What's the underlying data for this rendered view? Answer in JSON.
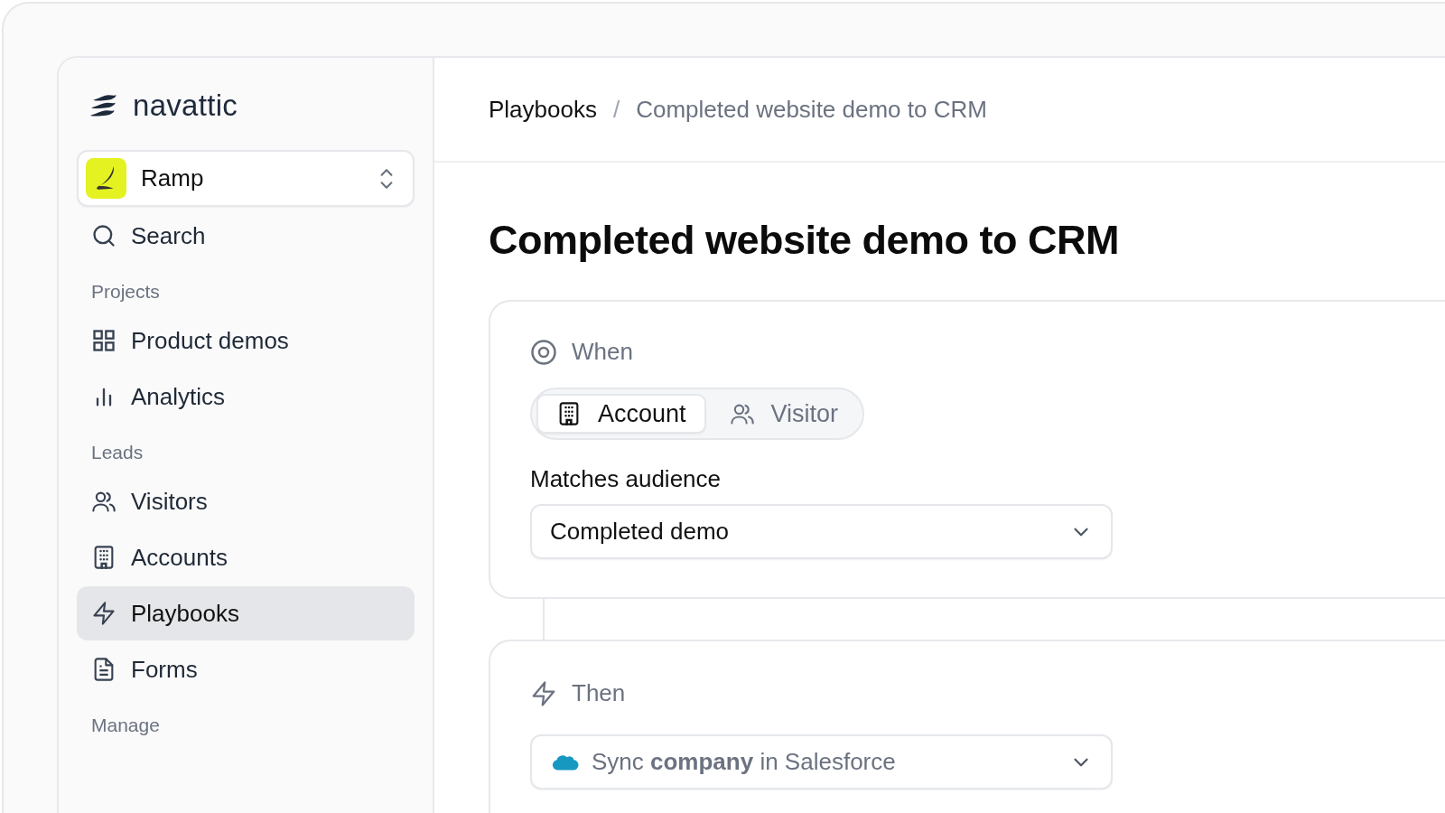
{
  "brand": {
    "name": "navattic"
  },
  "workspace": {
    "name": "Ramp"
  },
  "search": {
    "label": "Search"
  },
  "nav_sections": [
    {
      "heading": "Projects",
      "items": [
        {
          "label": "Product demos",
          "selected": false
        },
        {
          "label": "Analytics",
          "selected": false
        }
      ]
    },
    {
      "heading": "Leads",
      "items": [
        {
          "label": "Visitors",
          "selected": false
        },
        {
          "label": "Accounts",
          "selected": false
        },
        {
          "label": "Playbooks",
          "selected": true
        },
        {
          "label": "Forms",
          "selected": false
        }
      ]
    },
    {
      "heading": "Manage"
    }
  ],
  "breadcrumb": [
    {
      "label": "Playbooks",
      "current": false
    },
    {
      "label": "Completed website demo to CRM",
      "current": true
    }
  ],
  "breadcrumb_separator": "/",
  "title": "Completed website demo to CRM",
  "trigger": {
    "heading": "When",
    "segments": [
      {
        "label": "Account",
        "selected": true
      },
      {
        "label": "Visitor",
        "selected": false
      }
    ],
    "field_label": "Matches audience",
    "value": "Completed demo"
  },
  "action": {
    "heading": "Then",
    "value": "Sync **company** in Salesforce"
  }
}
